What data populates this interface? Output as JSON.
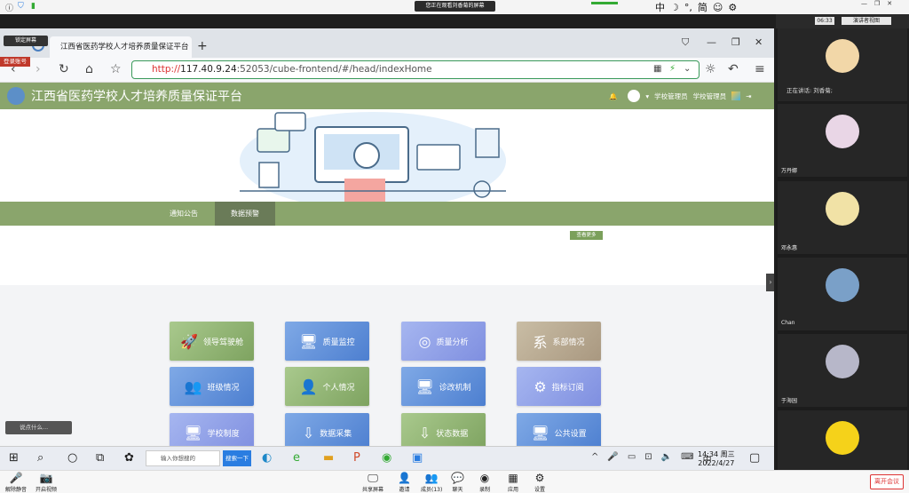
{
  "meeting": {
    "share_badge": "您正在观看刘香菊的屏幕",
    "ime": [
      "中",
      "☽",
      "°,",
      "简",
      "☺",
      "⚙"
    ],
    "time_chip": "06:33",
    "view_chip": "演讲者视图",
    "speaking": "正在讲话: 刘香菊;",
    "participants": [
      {
        "name": "",
        "color": "#f2d7a8"
      },
      {
        "name": "万丹娜",
        "color": "#e9d6e6"
      },
      {
        "name": "邓永惠",
        "color": "#f1e2a6"
      },
      {
        "name": "Chan",
        "color": "#7aa0c8"
      },
      {
        "name": "于海园",
        "color": "#b7b7c9"
      },
      {
        "name": "",
        "color": "#f5d21a"
      }
    ],
    "bottom": {
      "mute": "解除静音",
      "video": "开启视频",
      "share": "共享屏幕",
      "invite": "邀请",
      "members": "成员(13)",
      "chat": "聊天",
      "record": "录制",
      "apps": "应用",
      "settings": "设置",
      "leave": "离开会议"
    },
    "chat_placeholder": "说点什么..."
  },
  "browser": {
    "lock_label": "锁定屏幕",
    "login_label": "登录账号",
    "tab_title": "江西省医药学校人才培养质量保证平台",
    "url_http": "http://",
    "url_host": "117.40.9.24",
    "url_rest": ":52053/cube-frontend/#/head/indexHome"
  },
  "site": {
    "title": "江西省医药学校人才培养质量保证平台",
    "user1": "学校管理员",
    "user2": "学校管理员",
    "nav": [
      "通知公告",
      "数据预警"
    ],
    "more": "查看更多",
    "tiles": [
      {
        "label": "领导驾驶舱",
        "icon": "🚀",
        "style": "g"
      },
      {
        "label": "质量监控",
        "icon": "🖥",
        "style": "b"
      },
      {
        "label": "质量分析",
        "icon": "◎",
        "style": "p"
      },
      {
        "label": "系部情况",
        "icon": "系",
        "style": "t"
      },
      {
        "label": "班级情况",
        "icon": "👥",
        "style": "b"
      },
      {
        "label": "个人情况",
        "icon": "👤",
        "style": "g"
      },
      {
        "label": "诊改机制",
        "icon": "🖥",
        "style": "b"
      },
      {
        "label": "指标订阅",
        "icon": "⚙",
        "style": "p"
      },
      {
        "label": "学校制度",
        "icon": "🖥",
        "style": "p"
      },
      {
        "label": "数据采集",
        "icon": "⇩",
        "style": "b"
      },
      {
        "label": "状态数据",
        "icon": "⇩",
        "style": "g"
      },
      {
        "label": "公共设置",
        "icon": "🖥",
        "style": "b"
      }
    ]
  },
  "taskbar": {
    "search_placeholder": "输入你想搜的",
    "search_button": "搜索一下",
    "ime": "中",
    "time": "14:34 周三",
    "date": "2022/4/27"
  }
}
